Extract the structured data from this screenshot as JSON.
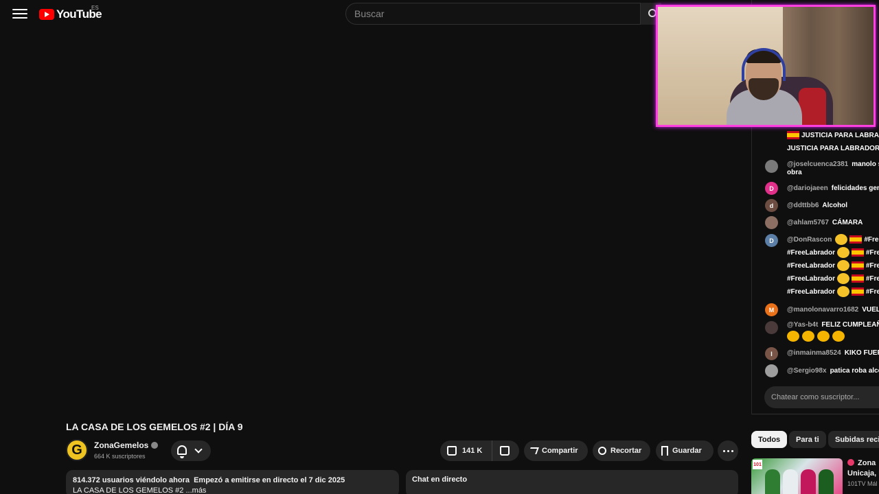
{
  "header": {
    "brand": "YouTube",
    "region": "ES",
    "search_placeholder": "Buscar"
  },
  "chat": {
    "top_line_1": "JUSTICIA PARA LABRAD",
    "top_line_2": "JUSTICIA PARA LABRADOR",
    "messages": [
      {
        "author": "@joselcuenca2381",
        "text": "manolo s",
        "text2": "obra",
        "avatar": "",
        "avatar_color": "#7a7a7a"
      },
      {
        "author": "@dariojaeen",
        "text": "felicidades gem",
        "avatar": "D",
        "avatar_color": "#e0308a"
      },
      {
        "author": "@ddttbb6",
        "text": "Alcohol",
        "avatar": "d",
        "avatar_color": "#6d4c41"
      },
      {
        "author": "@ahlam5767",
        "text": "CÁMARA",
        "avatar": "",
        "avatar_color": "#8d6e63"
      },
      {
        "author": "@DonRascon",
        "text": "#Fre",
        "lines": [
          "#FreeLabrador",
          "#FreeLabrador",
          "#FreeLabrador",
          "#FreeLabrador"
        ],
        "line_tail": "#Fre",
        "avatar": "D",
        "avatar_color": "#5c7fa8"
      },
      {
        "author": "@manolonavarro1682",
        "text": "VUELT",
        "avatar": "M",
        "avatar_color": "#e8711a"
      },
      {
        "author": "@Yas-b4t",
        "text": "FELIZ CUMPLEAÑ",
        "avatar": "",
        "avatar_color": "#4a3a3a"
      },
      {
        "author": "@inmainma8524",
        "text": "KIKO FUER",
        "avatar": "I",
        "avatar_color": "#795548"
      },
      {
        "author": "@Sergio98x",
        "text": "patica roba alco",
        "avatar": "",
        "avatar_color": "#9e9e9e"
      }
    ],
    "input_placeholder": "Chatear como suscriptor..."
  },
  "chips": [
    "Todos",
    "Para ti",
    "Subidas reci"
  ],
  "suggestion": {
    "title_1": "Zona",
    "title_2": "Unicaja, F",
    "channel": "101TV Mál",
    "badge": "101"
  },
  "video": {
    "title": "LA CASA DE LOS GEMELOS #2 | DÍA 9",
    "channel": "ZonaGemelos",
    "subscribers": "664 K suscriptores",
    "likes": "141 K",
    "share_label": "Compartir",
    "clip_label": "Recortar",
    "save_label": "Guardar",
    "viewers": "814.372 usuarios viéndolo ahora",
    "started": "Empezó a emitirse en directo el 7 dic 2025",
    "desc_line2": "LA CASA DE LOS GEMELOS #2",
    "more": "...más",
    "live_chat_label": "Chat en directo"
  }
}
